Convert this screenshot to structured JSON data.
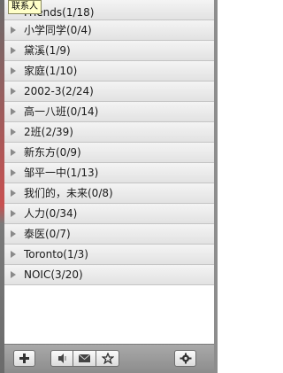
{
  "tooltip": "联系人",
  "groups": [
    {
      "label": "Friends(1/18)"
    },
    {
      "label": "小学同学(0/4)"
    },
    {
      "label": "黛溪(1/9)"
    },
    {
      "label": "家庭(1/10)"
    },
    {
      "label": "2002-3(2/24)"
    },
    {
      "label": "高一八班(0/14)"
    },
    {
      "label": "2班(2/39)"
    },
    {
      "label": "新东方(0/9)"
    },
    {
      "label": "邹平一中(1/13)"
    },
    {
      "label": "我们的，未来(0/8)"
    },
    {
      "label": "人力(0/34)"
    },
    {
      "label": "泰医(0/7)"
    },
    {
      "label": "Toronto(1/3)"
    },
    {
      "label": "NOIC(3/20)"
    }
  ],
  "toolbar": {
    "icons": [
      "plus-icon",
      "speaker-icon",
      "envelope-icon",
      "star-icon",
      "gear-icon"
    ]
  }
}
